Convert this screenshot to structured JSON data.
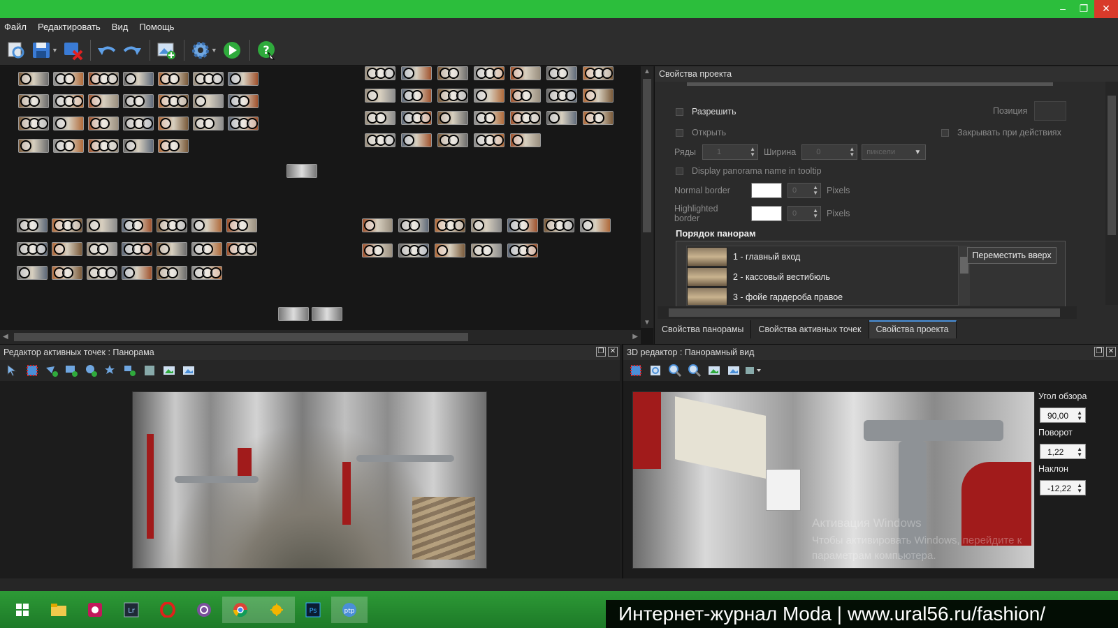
{
  "menu": [
    "Файл",
    "Редактировать",
    "Вид",
    "Помощь"
  ],
  "window": {
    "minimize": "–",
    "restore": "❐",
    "close": "✕"
  },
  "properties": {
    "title": "Свойства проекта",
    "enable_label": "Разрешить",
    "position_label": "Позиция",
    "open_label": "Открыть",
    "close_on_action_label": "Закрывать при действиях",
    "rows_label": "Ряды",
    "rows_value": "1",
    "width_label": "Ширина",
    "width_value": "0",
    "unit_value": "пиксели",
    "tooltip_label": "Display panorama name in tooltip",
    "normal_border_label": "Normal border",
    "normal_border_value": "0",
    "highlighted_border_label": "Highlighted border",
    "highlighted_border_value": "0",
    "pixels_label": "Pixels",
    "order_heading": "Порядок панорам",
    "order_items": [
      "1 - главный вход",
      "2 - кассовый вестибюль",
      "3 - фойе гардероба правое"
    ],
    "move_up_button": "Переместить вверх",
    "tabs": [
      "Свойства панорамы",
      "Свойства активных точек",
      "Свойства проекта"
    ]
  },
  "hotspot_editor": {
    "title": "Редактор активных точек : Панорама"
  },
  "editor3d": {
    "title": "3D редактор : Панорамный вид",
    "fov_label": "Угол обзора",
    "fov_value": "90,00",
    "pan_label": "Поворот",
    "pan_value": "1,22",
    "tilt_label": "Наклон",
    "tilt_value": "-12,22"
  },
  "watermark": {
    "line1": "Активация Windows",
    "line2": "Чтобы активировать Windows, перейдите к",
    "line3": "параметрам компьютера."
  },
  "banner": "Интернет-журнал Moda | www.ural56.ru/fashion/",
  "taskbar": [
    "windows-start",
    "file-explorer",
    "camera-app",
    "lightroom",
    "opera",
    "viber",
    "chrome",
    "pano-app",
    "photoshop",
    "ptp"
  ],
  "taskbar_labels": {
    "lightroom": "Lr",
    "photoshop": "Ps",
    "ptp": "ptp"
  },
  "colors": {
    "titlebar": "#2cbe3c",
    "close": "#d83a2a",
    "accent_tab": "#4a90d9",
    "taskbar": "#1d7a28"
  }
}
